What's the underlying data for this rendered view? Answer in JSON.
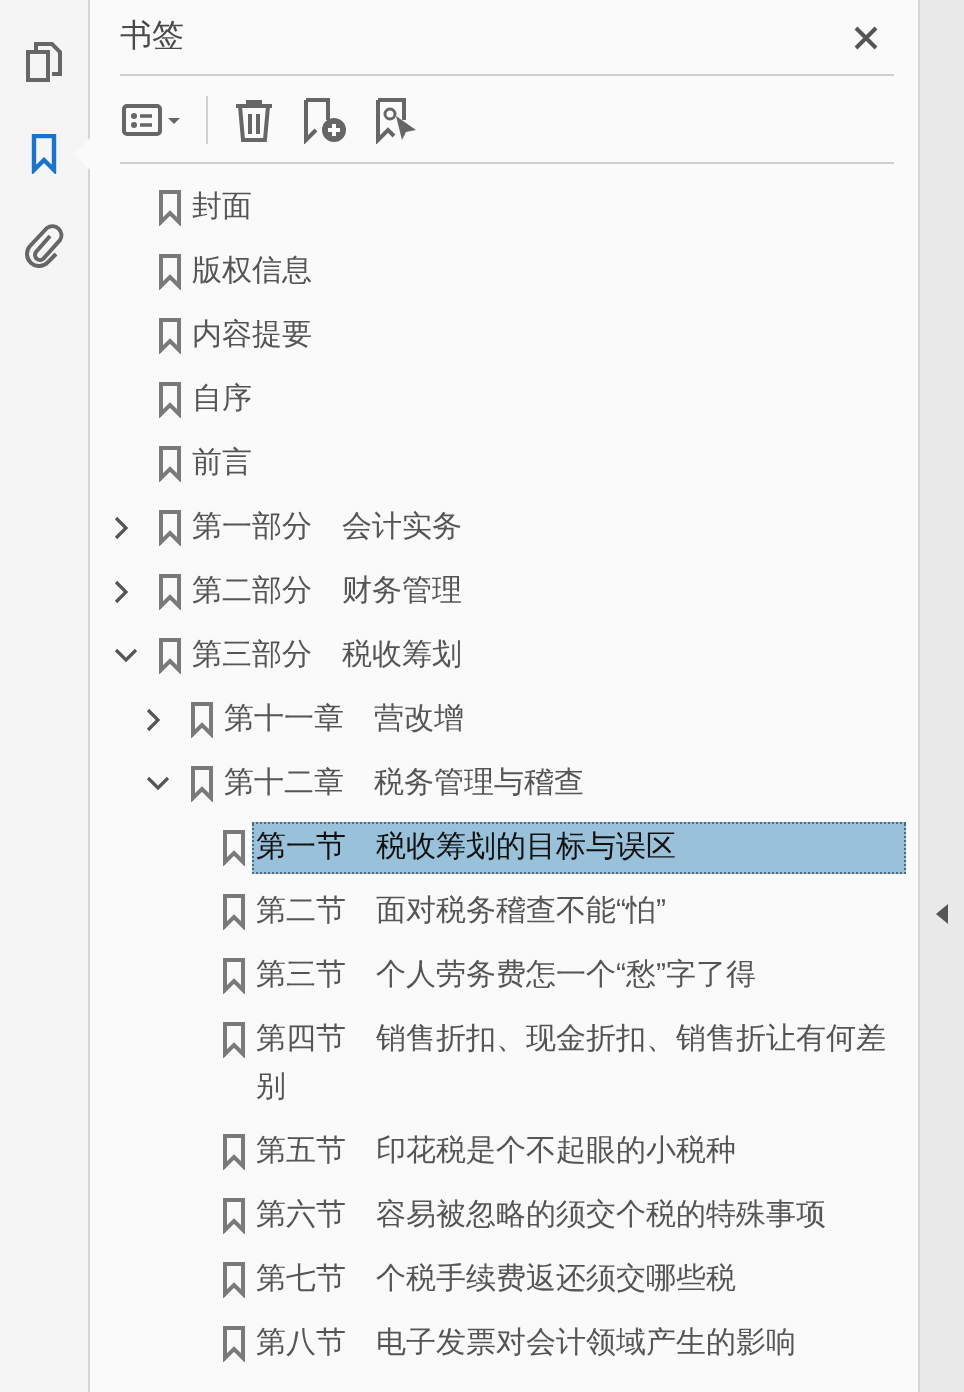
{
  "sidebar_tools": [
    {
      "kind": "pages",
      "selected": false
    },
    {
      "kind": "bookmarks",
      "selected": true
    },
    {
      "kind": "attachments",
      "selected": false
    }
  ],
  "panel": {
    "title": "书签"
  },
  "toolbar": [
    {
      "kind": "options"
    },
    {
      "kind": "delete"
    },
    {
      "kind": "new"
    },
    {
      "kind": "new-from-selection"
    }
  ],
  "bookmarks": [
    {
      "label": "封面",
      "selected": false
    },
    {
      "label": "版权信息",
      "selected": false
    },
    {
      "label": "内容提要",
      "selected": false
    },
    {
      "label": "自序",
      "selected": false
    },
    {
      "label": "前言",
      "selected": false
    },
    {
      "label": "第一部分　会计实务",
      "selected": false,
      "expanded": false
    },
    {
      "label": "第二部分　财务管理",
      "selected": false,
      "expanded": false
    },
    {
      "label": "第三部分　税收筹划",
      "selected": false,
      "expanded": true,
      "children": [
        {
          "label": "第十一章　营改增",
          "selected": false,
          "expanded": false
        },
        {
          "label": "第十二章　税务管理与稽查",
          "selected": false,
          "expanded": true,
          "children": [
            {
              "label": "第一节　税收筹划的目标与误区",
              "selected": true
            },
            {
              "label": "第二节　面对税务稽查不能“怕”",
              "selected": false
            },
            {
              "label": "第三节　个人劳务费怎一个“愁”字了得",
              "selected": false
            },
            {
              "label": "第四节　销售折扣、现金折扣、销售折让有何差别",
              "selected": false
            },
            {
              "label": "第五节　印花税是个不起眼的小税种",
              "selected": false
            },
            {
              "label": "第六节　容易被忽略的须交个税的特殊事项",
              "selected": false
            },
            {
              "label": "第七节　个税手续费返还须交哪些税",
              "selected": false
            },
            {
              "label": "第八节　电子发票对会计领域产生的影响",
              "selected": false
            }
          ]
        }
      ]
    }
  ]
}
